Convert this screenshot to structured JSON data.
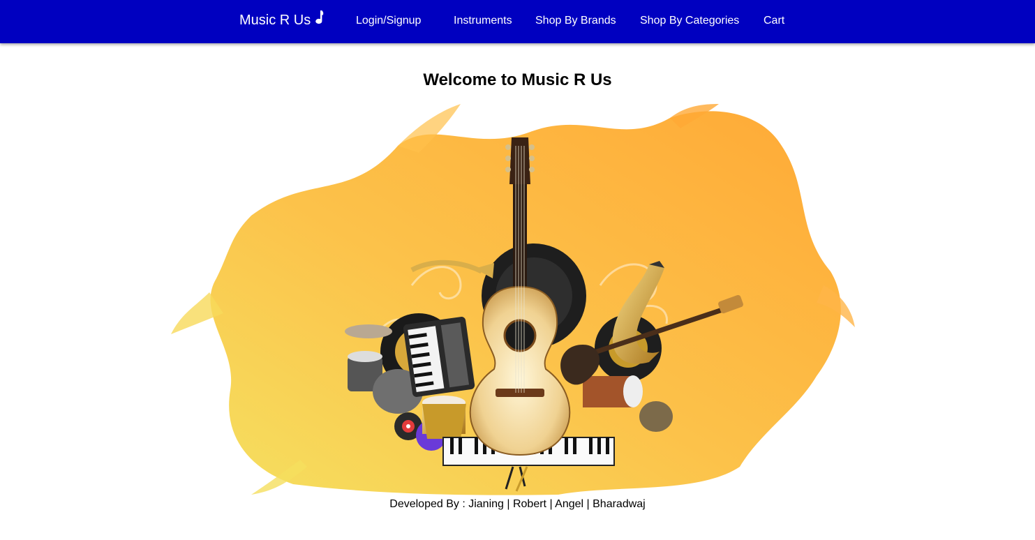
{
  "nav": {
    "brand": "Music R Us",
    "brand_icon": "music-note-icon",
    "links": [
      {
        "label": "Login/Signup"
      },
      {
        "label": "Instruments"
      },
      {
        "label": "Shop By Brands"
      },
      {
        "label": "Shop By Categories"
      },
      {
        "label": "Cart"
      }
    ]
  },
  "main": {
    "title": "Welcome to Music R Us",
    "hero_image": "musical-instruments-collage"
  },
  "footer": {
    "credits": "Developed By : Jianing | Robert | Angel | Bharadwaj"
  },
  "colors": {
    "navbar": "#0000c0",
    "nav_text": "#ffffff",
    "splash_orange": "#ffa938",
    "splash_yellow": "#f6d84a"
  }
}
